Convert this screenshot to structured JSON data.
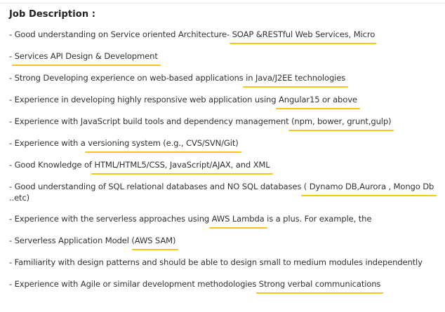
{
  "heading": "Job Description :",
  "accent_color": "#f5c518",
  "items": [
    {
      "before": "- Good understanding on Service oriented Architecture- ",
      "highlight": "SOAP &RESTful Web Services, Micro",
      "after": ""
    },
    {
      "before": "- ",
      "highlight": "Services API Design & Development",
      "after": ""
    },
    {
      "before": "- Strong Developing experience on web-based applications ",
      "highlight": "in Java/J2EE technologies",
      "after": ""
    },
    {
      "before": "- Experience in developing highly responsive web application using ",
      "highlight": "Angular15 or above",
      "after": ""
    },
    {
      "before": "- Experience with JavaScript build tools and dependency management ",
      "highlight": "(npm, bower, grunt,gulp)",
      "after": ""
    },
    {
      "before": "- Experience with a ",
      "highlight": "versioning system (e.g., CVS/SVN/Git)",
      "after": ""
    },
    {
      "before": "- Good Knowledge of ",
      "highlight": "HTML/HTML5/CSS, JavaScript/AJAX, and XML",
      "after": ""
    },
    {
      "before": "- Good understanding of SQL relational databases and NO SQL databases ",
      "highlight": "( Dynamo DB,Aurora , Mongo Db",
      "after": " ..etc)"
    },
    {
      "before": "- Experience with the serverless approaches using ",
      "highlight": "AWS Lambda",
      "after": " is a plus. For example, the"
    },
    {
      "before": "- Serverless Application Model (",
      "highlight": "AWS SAM)",
      "after": ""
    },
    {
      "before": "- Familiarity with design patterns and should be able to design small to medium modules independently",
      "highlight": "",
      "after": ""
    },
    {
      "before": "- Experience with Agile or similar development methodologies ",
      "highlight": "Strong verbal communications",
      "after": ""
    }
  ]
}
